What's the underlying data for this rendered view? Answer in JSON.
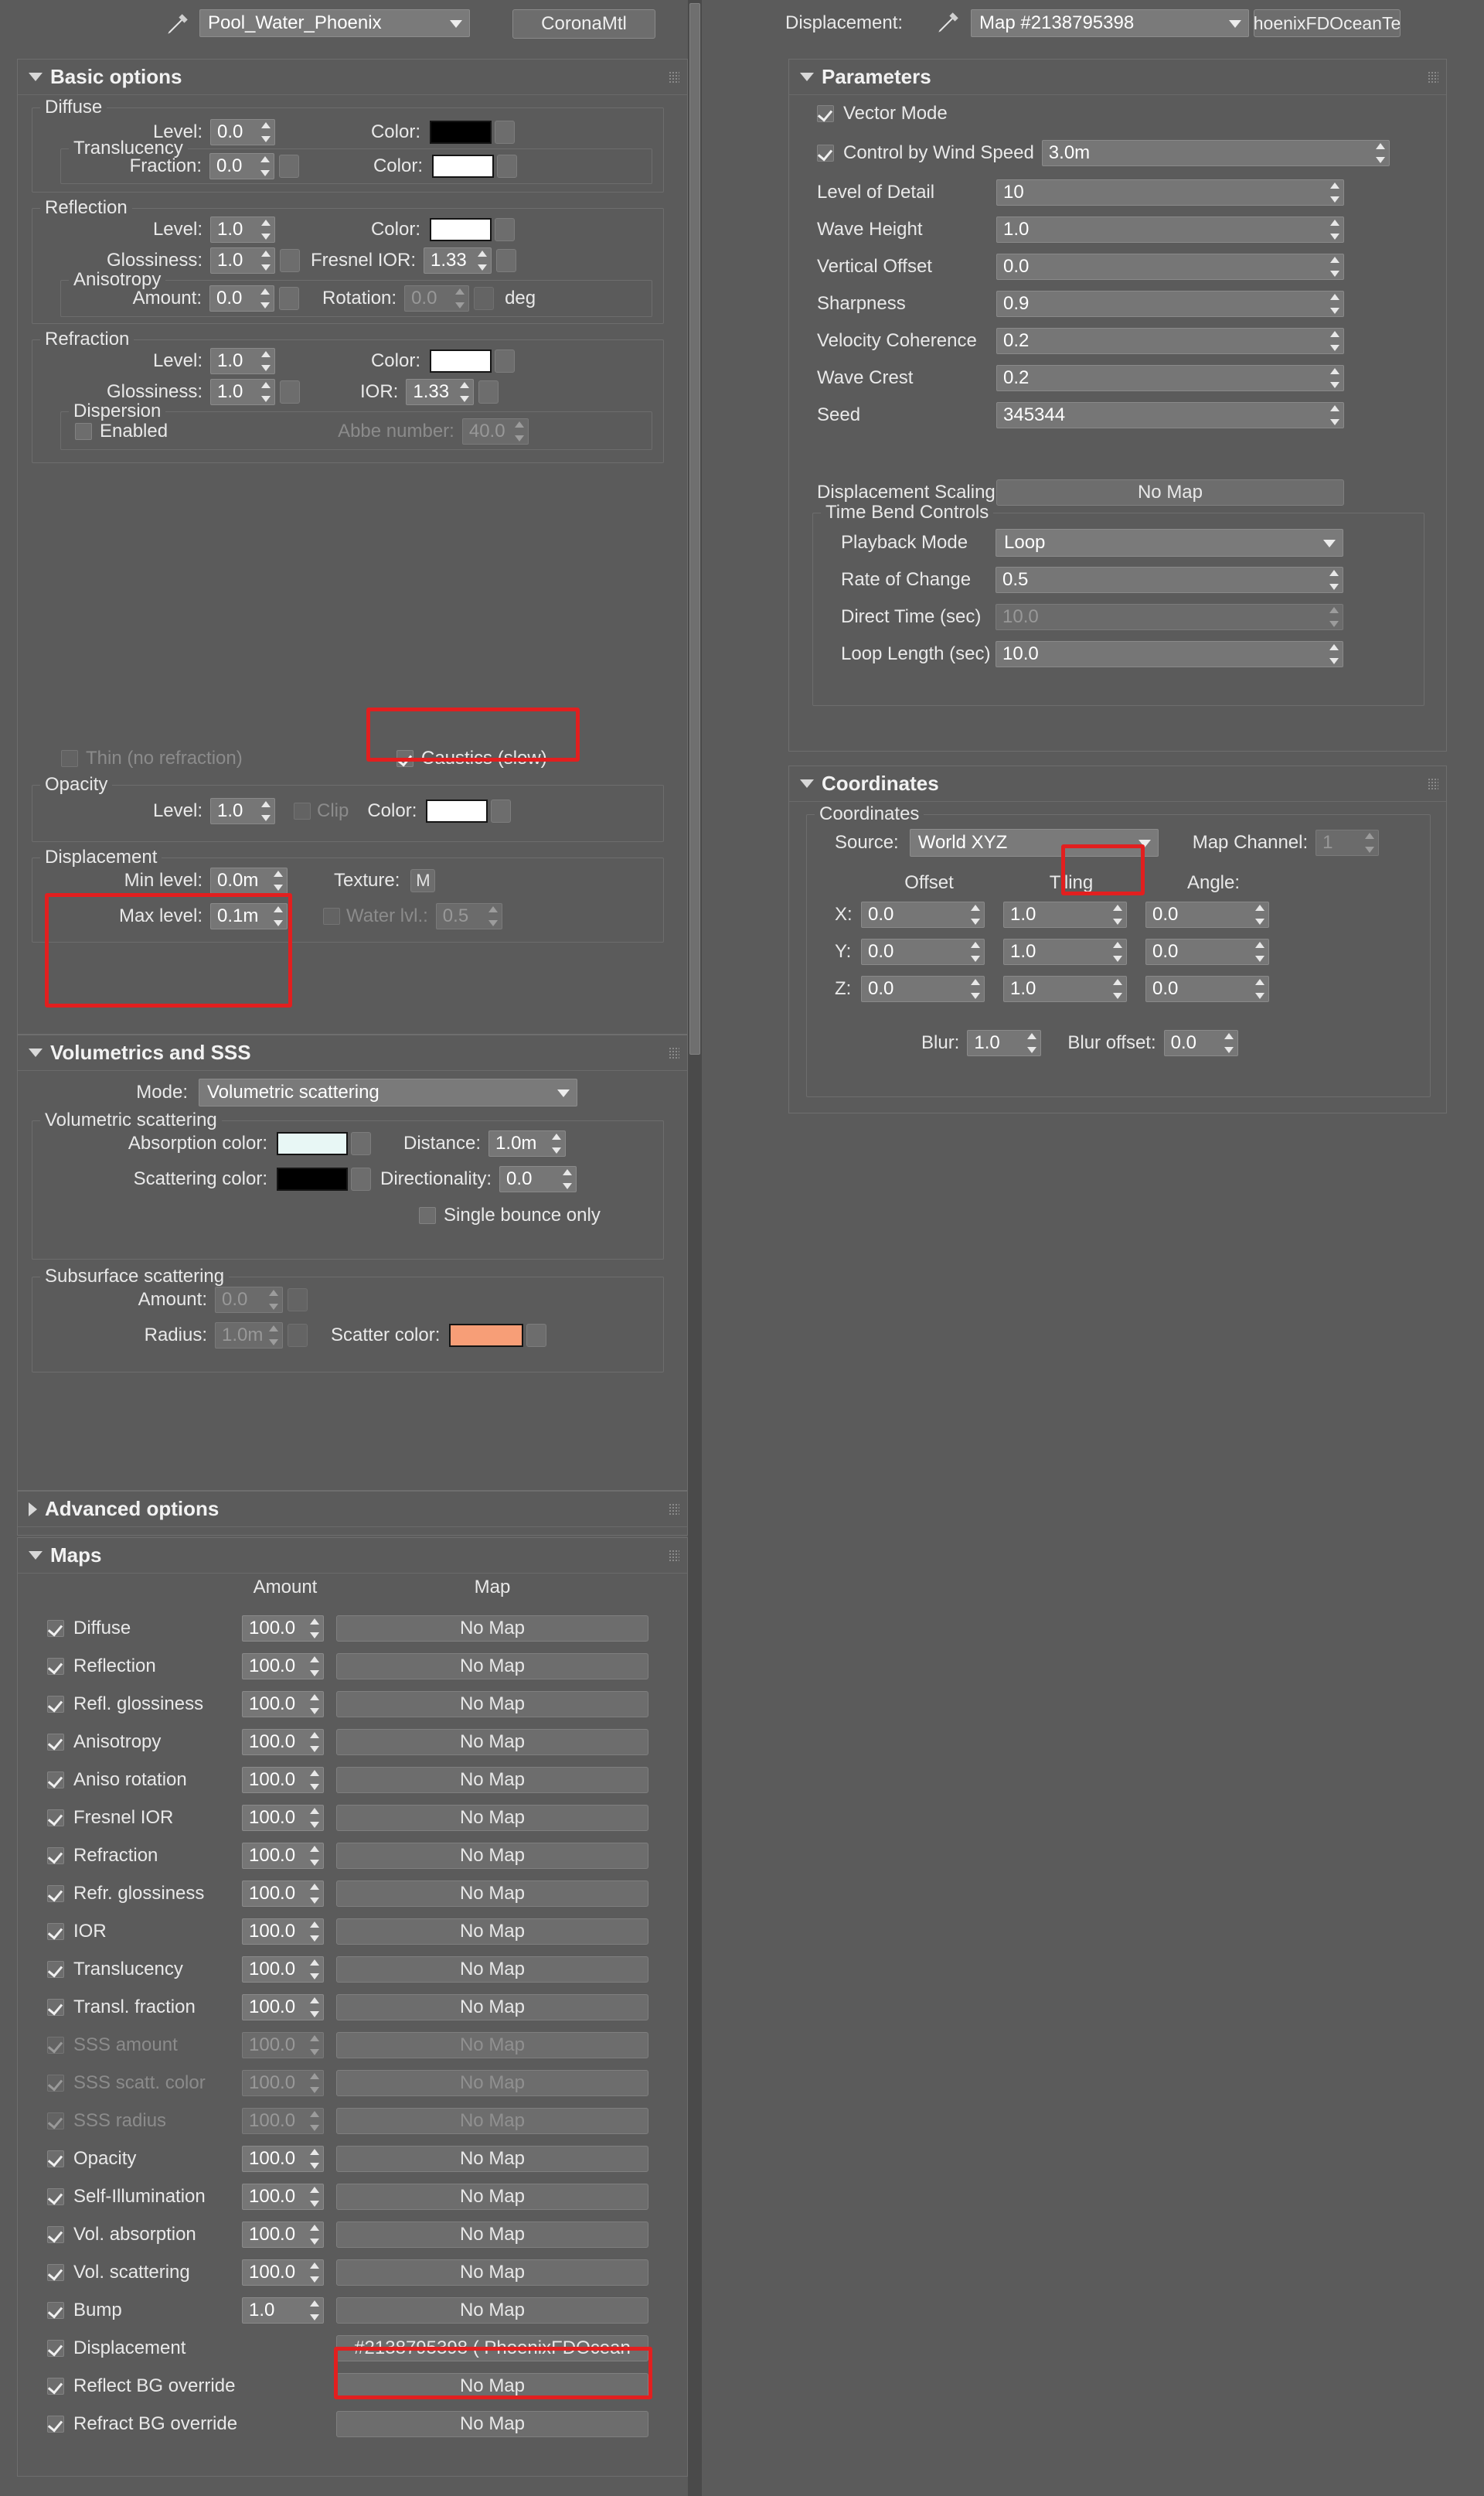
{
  "material_toolbar": {
    "eyedropper_icon": "eyedropper-icon",
    "material_name": "Pool_Water_Phoenix",
    "material_type": "CoronaMtl"
  },
  "basic_options": {
    "title": "Basic options",
    "diffuse": {
      "group_label": "Diffuse",
      "level_label": "Level:",
      "level_value": "0.0",
      "color_label": "Color:",
      "color_hex": "#000000",
      "translucency": {
        "group_label": "Translucency",
        "fraction_label": "Fraction:",
        "fraction_value": "0.0",
        "color_label": "Color:",
        "color_hex": "#ffffff"
      }
    },
    "reflection": {
      "group_label": "Reflection",
      "level_label": "Level:",
      "level_value": "1.0",
      "color_label": "Color:",
      "color_hex": "#ffffff",
      "glossiness_label": "Glossiness:",
      "glossiness_value": "1.0",
      "fresnel_label": "Fresnel IOR:",
      "fresnel_value": "1.33",
      "anisotropy": {
        "group_label": "Anisotropy",
        "amount_label": "Amount:",
        "amount_value": "0.0",
        "rotation_label": "Rotation:",
        "rotation_value": "0.0",
        "rotation_unit": "deg"
      }
    },
    "refraction": {
      "group_label": "Refraction",
      "level_label": "Level:",
      "level_value": "1.0",
      "color_label": "Color:",
      "color_hex": "#ffffff",
      "glossiness_label": "Glossiness:",
      "glossiness_value": "1.0",
      "ior_label": "IOR:",
      "ior_value": "1.33",
      "dispersion": {
        "group_label": "Dispersion",
        "enabled_label": "Enabled",
        "enabled_checked": false,
        "abbe_label": "Abbe number:",
        "abbe_value": "40.0"
      },
      "thin_label": "Thin (no refraction)",
      "thin_checked": false,
      "caustics_label": "Caustics (slow)",
      "caustics_checked": true
    },
    "opacity": {
      "group_label": "Opacity",
      "level_label": "Level:",
      "level_value": "1.0",
      "clip_label": "Clip",
      "clip_checked": false,
      "color_label": "Color:",
      "color_hex": "#ffffff"
    },
    "displacement": {
      "group_label": "Displacement",
      "min_label": "Min level:",
      "min_value": "0.0m",
      "max_label": "Max level:",
      "max_value": "0.1m",
      "texture_label": "Texture:",
      "texture_button": "M",
      "water_label": "Water lvl.:",
      "water_value": "0.5",
      "water_checked": false
    }
  },
  "volumetrics": {
    "title": "Volumetrics and SSS",
    "mode_label": "Mode:",
    "mode_value": "Volumetric scattering",
    "volumetric_scattering": {
      "group_label": "Volumetric scattering",
      "absorption_label": "Absorption color:",
      "absorption_hex": "#e8f7f5",
      "distance_label": "Distance:",
      "distance_value": "1.0m",
      "scattering_label": "Scattering color:",
      "scattering_hex": "#000000",
      "directionality_label": "Directionality:",
      "directionality_value": "0.0",
      "single_bounce_label": "Single bounce only",
      "single_bounce_checked": false
    },
    "sss": {
      "group_label": "Subsurface scattering",
      "amount_label": "Amount:",
      "amount_value": "0.0",
      "radius_label": "Radius:",
      "radius_value": "1.0m",
      "scatter_label": "Scatter color:",
      "scatter_hex": "#f79e77"
    }
  },
  "advanced_options": {
    "title": "Advanced options"
  },
  "maps": {
    "title": "Maps",
    "col_amount": "Amount",
    "col_map": "Map",
    "no_map": "No Map",
    "rows": [
      {
        "name": "Diffuse",
        "checked": true,
        "amount": "100.0",
        "map": "No Map",
        "dim": false
      },
      {
        "name": "Reflection",
        "checked": true,
        "amount": "100.0",
        "map": "No Map",
        "dim": false
      },
      {
        "name": "Refl. glossiness",
        "checked": true,
        "amount": "100.0",
        "map": "No Map",
        "dim": false
      },
      {
        "name": "Anisotropy",
        "checked": true,
        "amount": "100.0",
        "map": "No Map",
        "dim": false
      },
      {
        "name": "Aniso rotation",
        "checked": true,
        "amount": "100.0",
        "map": "No Map",
        "dim": false
      },
      {
        "name": "Fresnel IOR",
        "checked": true,
        "amount": "100.0",
        "map": "No Map",
        "dim": false
      },
      {
        "name": "Refraction",
        "checked": true,
        "amount": "100.0",
        "map": "No Map",
        "dim": false
      },
      {
        "name": "Refr. glossiness",
        "checked": true,
        "amount": "100.0",
        "map": "No Map",
        "dim": false
      },
      {
        "name": "IOR",
        "checked": true,
        "amount": "100.0",
        "map": "No Map",
        "dim": false
      },
      {
        "name": "Translucency",
        "checked": true,
        "amount": "100.0",
        "map": "No Map",
        "dim": false
      },
      {
        "name": "Transl. fraction",
        "checked": true,
        "amount": "100.0",
        "map": "No Map",
        "dim": false
      },
      {
        "name": "SSS amount",
        "checked": true,
        "amount": "100.0",
        "map": "No Map",
        "dim": true
      },
      {
        "name": "SSS scatt. color",
        "checked": true,
        "amount": "100.0",
        "map": "No Map",
        "dim": true
      },
      {
        "name": "SSS radius",
        "checked": true,
        "amount": "100.0",
        "map": "No Map",
        "dim": true
      },
      {
        "name": "Opacity",
        "checked": true,
        "amount": "100.0",
        "map": "No Map",
        "dim": false
      },
      {
        "name": "Self-Illumination",
        "checked": true,
        "amount": "100.0",
        "map": "No Map",
        "dim": false
      },
      {
        "name": "Vol. absorption",
        "checked": true,
        "amount": "100.0",
        "map": "No Map",
        "dim": false
      },
      {
        "name": "Vol. scattering",
        "checked": true,
        "amount": "100.0",
        "map": "No Map",
        "dim": false
      },
      {
        "name": "Bump",
        "checked": true,
        "amount": "1.0",
        "map": "No Map",
        "dim": false
      },
      {
        "name": "Displacement",
        "checked": true,
        "amount": "",
        "map": "#2138795398  ( PhoenixFDOcean",
        "dim": false
      },
      {
        "name": "Reflect BG override",
        "checked": true,
        "amount": "",
        "map": "No Map",
        "dim": false
      },
      {
        "name": "Refract BG override",
        "checked": true,
        "amount": "",
        "map": "No Map",
        "dim": false
      }
    ]
  },
  "displacement_panel": {
    "toolbar": {
      "slot_label": "Displacement:",
      "eyedropper_icon": "eyedropper-icon",
      "map_name": "Map #2138795398",
      "map_type": "hoenixFDOceanTe"
    },
    "parameters": {
      "title": "Parameters",
      "vector_mode_label": "Vector Mode",
      "vector_mode_checked": true,
      "wind_speed_label": "Control by Wind Speed",
      "wind_speed_checked": true,
      "wind_speed_value": "3.0m",
      "rows": [
        {
          "label": "Level of Detail",
          "value": "10",
          "dim": false
        },
        {
          "label": "Wave Height",
          "value": "1.0",
          "dim": false
        },
        {
          "label": "Vertical Offset",
          "value": "0.0",
          "dim": false
        },
        {
          "label": "Sharpness",
          "value": "0.9",
          "dim": false
        },
        {
          "label": "Velocity Coherence",
          "value": "0.2",
          "dim": false
        },
        {
          "label": "Wave Crest",
          "value": "0.2",
          "dim": false
        },
        {
          "label": "Seed",
          "value": "345344",
          "dim": false
        }
      ],
      "displacement_scaling_label": "Displacement Scaling",
      "displacement_scaling_value": "No Map",
      "time_bend": {
        "group_label": "Time Bend Controls",
        "playback_mode_label": "Playback Mode",
        "playback_mode_value": "Loop",
        "rate_label": "Rate of Change",
        "rate_value": "0.5",
        "direct_time_label": "Direct Time (sec)",
        "direct_time_value": "10.0",
        "loop_length_label": "Loop Length (sec)",
        "loop_length_value": "10.0"
      }
    },
    "coordinates": {
      "title": "Coordinates",
      "group_label": "Coordinates",
      "source_label": "Source:",
      "source_value": "World XYZ",
      "map_channel_label": "Map Channel:",
      "map_channel_value": "1",
      "col_offset": "Offset",
      "col_tiling": "Tiling",
      "col_angle": "Angle:",
      "axes": [
        {
          "axis": "X:",
          "offset": "0.0",
          "tiling": "1.0",
          "angle": "0.0"
        },
        {
          "axis": "Y:",
          "offset": "0.0",
          "tiling": "1.0",
          "angle": "0.0"
        },
        {
          "axis": "Z:",
          "offset": "0.0",
          "tiling": "1.0",
          "angle": "0.0"
        }
      ],
      "blur_label": "Blur:",
      "blur_value": "1.0",
      "blur_offset_label": "Blur offset:",
      "blur_offset_value": "0.0"
    }
  },
  "highlight_color": "#e21f1f"
}
